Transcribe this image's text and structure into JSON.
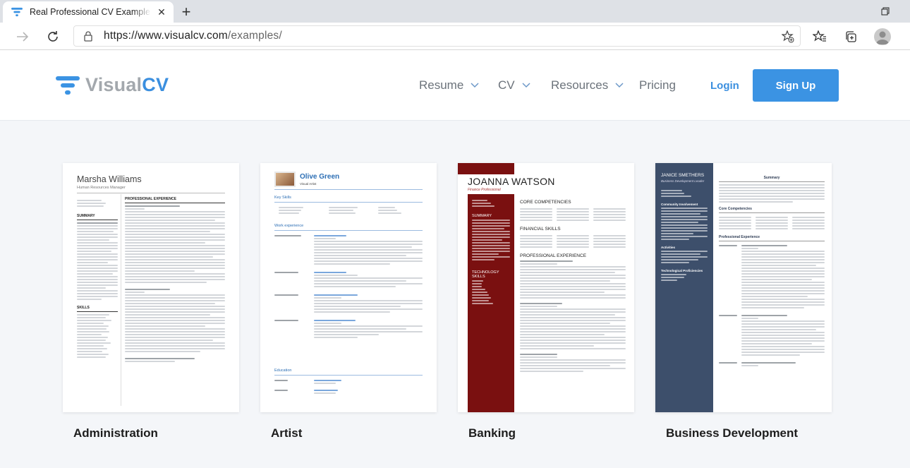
{
  "browser": {
    "tab_title": "Real Professional CV Example &",
    "url_host": "https://www.visualcv.com",
    "url_path": "/examples/"
  },
  "site": {
    "logo_part1": "Visual",
    "logo_part2": "CV",
    "nav": {
      "resume": "Resume",
      "cv": "CV",
      "resources": "Resources",
      "pricing": "Pricing"
    },
    "login": "Login",
    "signup": "Sign Up",
    "colors": {
      "brand_blue": "#3b93e3",
      "logo_grey": "#a3a8ad",
      "banking_red": "#7a1010",
      "bizdev_navy": "#3d4f6b"
    }
  },
  "examples": [
    {
      "label": "Administration",
      "preview": {
        "name": "Marsha Williams",
        "subtitle": "Human Resources Manager",
        "sections": [
          "SUMMARY",
          "SKILLS",
          "PROFESSIONAL EXPERIENCE"
        ]
      }
    },
    {
      "label": "Artist",
      "preview": {
        "name": "Olive Green",
        "subtitle": "Visual Artist",
        "sections": [
          "Key Skills",
          "Work experience",
          "Education"
        ]
      }
    },
    {
      "label": "Banking",
      "preview": {
        "name": "JOANNA WATSON",
        "subtitle": "Finance Professional",
        "sections": [
          "SUMMARY",
          "TECHNOLOGY SKILLS",
          "CORE COMPETENCIES",
          "FINANCIAL SKILLS",
          "PROFESSIONAL EXPERIENCE"
        ]
      }
    },
    {
      "label": "Business Development",
      "preview": {
        "name": "JANICE SMETHERS",
        "subtitle": "Business Development Leader",
        "sections": [
          "Community Involvement",
          "Activities",
          "Technological Proficiencies",
          "Summary",
          "Core Competencies",
          "Professional Experience"
        ]
      }
    }
  ]
}
